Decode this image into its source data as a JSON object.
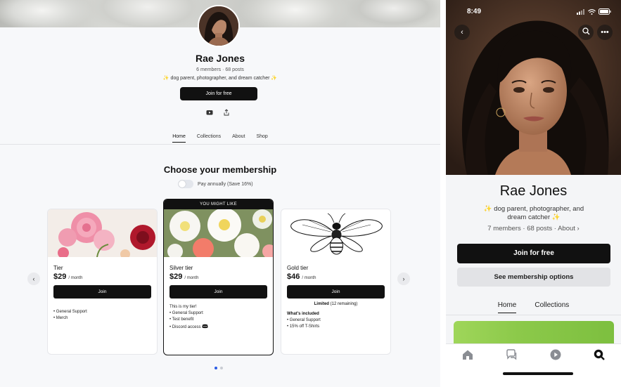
{
  "desktop": {
    "creator_name": "Rae Jones",
    "stats": "6 members  ·  68 posts",
    "bio": "✨ dog parent, photographer, and dream catcher ✨",
    "join_label": "Join for free",
    "icons": [
      "youtube-icon",
      "share-icon"
    ],
    "tabs": [
      {
        "label": "Home",
        "active": true
      },
      {
        "label": "Collections",
        "active": false
      },
      {
        "label": "About",
        "active": false
      },
      {
        "label": "Shop",
        "active": false
      }
    ],
    "membership_heading": "Choose your membership",
    "toggle_label": "Pay annually (Save 16%)",
    "toggle_on": false,
    "tiers": [
      {
        "name": "Tier",
        "price": "$29",
        "per": "/ month",
        "join_label": "Join",
        "benefits": [
          "General Support",
          "Merch"
        ]
      },
      {
        "badge": "YOU MIGHT LIKE",
        "name": "Silver tier",
        "price": "$29",
        "per": "/ month",
        "join_label": "Join",
        "description": "This is my tier!",
        "benefits": [
          "General Support",
          "Test benefit",
          "Discord access"
        ]
      },
      {
        "name": "Gold tier",
        "price": "$46",
        "per": "/ month",
        "join_label": "Join",
        "limited_bold": "Limited",
        "limited_rest": "(12 remaining)",
        "included_heading": "What's included",
        "benefits": [
          "General Support",
          "15% off T-Shirts"
        ]
      }
    ],
    "carousel_pages": 2,
    "carousel_active_page": 1
  },
  "phone": {
    "time": "8:49",
    "creator_name": "Rae Jones",
    "bio": "✨ dog parent, photographer, and dream catcher ✨",
    "stats": "7 members  ·  68 posts  ·  About ›",
    "join_label": "Join for free",
    "see_label": "See membership options",
    "tabs": [
      {
        "label": "Home",
        "active": true
      },
      {
        "label": "Collections",
        "active": false
      }
    ],
    "nav_icons": [
      "home-icon",
      "chat-icon",
      "play-icon",
      "search-icon"
    ]
  },
  "colors": {
    "primary_button": "#111111",
    "accent_dot": "#2b5be5",
    "secondary_button": "#e2e3e6"
  }
}
